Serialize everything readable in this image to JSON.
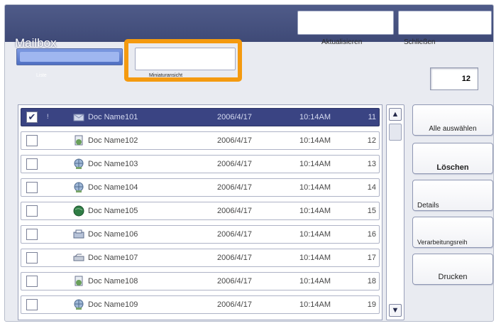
{
  "header": {
    "title": "Mailbox",
    "refresh_label": "Aktualisieren",
    "close_label": "Schließen"
  },
  "view": {
    "list_label": "Liste",
    "thumbnail_label": "Miniaturansicht"
  },
  "document_count": "12",
  "documents": [
    {
      "name": "Doc Name101",
      "date": "2006/4/17",
      "time": "10:14AM",
      "page": "11",
      "selected": true,
      "flag": "!",
      "icon": "mail-document-icon"
    },
    {
      "name": "Doc Name102",
      "date": "2006/4/17",
      "time": "10:14AM",
      "page": "12",
      "selected": false,
      "icon": "scan-document-icon"
    },
    {
      "name": "Doc Name103",
      "date": "2006/4/17",
      "time": "10:14AM",
      "page": "13",
      "selected": false,
      "icon": "globe-document-icon"
    },
    {
      "name": "Doc Name104",
      "date": "2006/4/17",
      "time": "10:14AM",
      "page": "14",
      "selected": false,
      "icon": "globe-document-icon"
    },
    {
      "name": "Doc Name105",
      "date": "2006/4/17",
      "time": "10:14AM",
      "page": "15",
      "selected": false,
      "icon": "globe-green-document-icon"
    },
    {
      "name": "Doc Name106",
      "date": "2006/4/17",
      "time": "10:14AM",
      "page": "16",
      "selected": false,
      "icon": "printer-document-icon"
    },
    {
      "name": "Doc Name107",
      "date": "2006/4/17",
      "time": "10:14AM",
      "page": "17",
      "selected": false,
      "icon": "fax-document-icon"
    },
    {
      "name": "Doc Name108",
      "date": "2006/4/17",
      "time": "10:14AM",
      "page": "18",
      "selected": false,
      "icon": "scan-document-icon"
    },
    {
      "name": "Doc Name109",
      "date": "2006/4/17",
      "time": "10:14AM",
      "page": "19",
      "selected": false,
      "icon": "globe-document-icon"
    }
  ],
  "actions": {
    "select_all": "Alle auswählen",
    "delete": "Löschen",
    "details": "Details",
    "processing": "Verarbeitungsreih",
    "print": "Drucken"
  },
  "colors": {
    "header": "#4f5b89",
    "highlight": "#f49a10",
    "selected_row": "#3a4483"
  }
}
